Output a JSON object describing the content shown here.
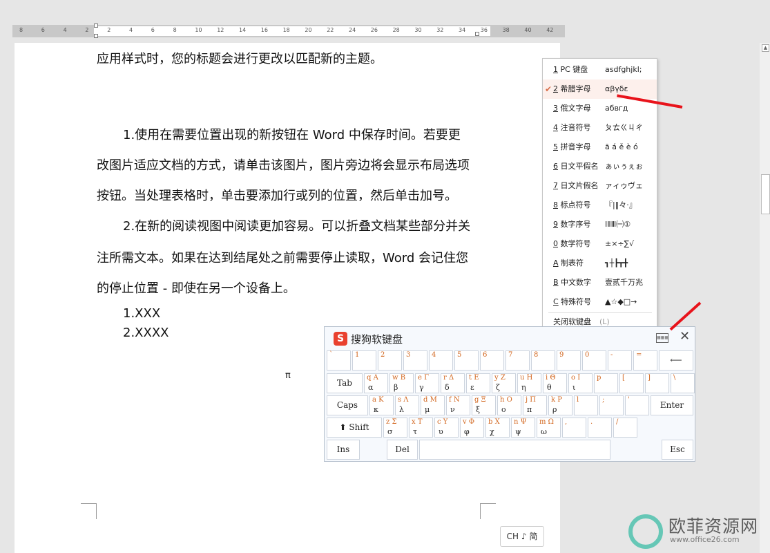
{
  "ruler": {
    "numbers": [
      "8",
      "6",
      "4",
      "2",
      "2",
      "4",
      "6",
      "8",
      "10",
      "12",
      "14",
      "16",
      "18",
      "20",
      "22",
      "24",
      "26",
      "28",
      "30",
      "32",
      "34",
      "36",
      "38",
      "40",
      "42"
    ]
  },
  "document": {
    "line_intro": "应用样式时，您的标题会进行更改以匹配新的主题。",
    "p1_lines": [
      "1.使用在需要位置出现的新按钮在 Word 中保存时间。若要更",
      "改图片适应文档的方式，请单击该图片，图片旁边将会显示布局选项",
      "按钮。当处理表格时，单击要添加行或列的位置，然后单击加号。"
    ],
    "p2_lines": [
      "2.在新的阅读视图中阅读更加容易。可以折叠文档某些部分并关",
      "注所需文本。如果在达到结尾处之前需要停止读取，Word 会记住您",
      "的停止位置 - 即使在另一个设备上。"
    ],
    "list": [
      "1.XXX",
      "2.XXXX"
    ],
    "pi": "π"
  },
  "menu": {
    "items": [
      {
        "key": "1",
        "label": " PC 键盘",
        "sample": "asdfghjkl;"
      },
      {
        "key": "2",
        "label": " 希腊字母",
        "sample": "αβγδε",
        "checked": true
      },
      {
        "key": "3",
        "label": " 俄文字母",
        "sample": "абвгд"
      },
      {
        "key": "4",
        "label": " 注音符号",
        "sample": "ㄆㄊㄍㄐㄔ"
      },
      {
        "key": "5",
        "label": " 拼音字母",
        "sample": "ā á ě è ó"
      },
      {
        "key": "6",
        "label": " 日文平假名",
        "sample": "ぁぃぅぇぉ"
      },
      {
        "key": "7",
        "label": " 日文片假名",
        "sample": "ァィゥヴェ"
      },
      {
        "key": "8",
        "label": " 标点符号",
        "sample": "『|‖々·』"
      },
      {
        "key": "9",
        "label": " 数字序号",
        "sample": "ⅠⅡⅢ㈠①"
      },
      {
        "key": "0",
        "label": " 数学符号",
        "sample": "±×÷∑√"
      },
      {
        "key": "A",
        "label": " 制表符",
        "sample": "┓┼┣┳╋"
      },
      {
        "key": "B",
        "label": " 中文数字",
        "sample": "壹贰千万兆"
      },
      {
        "key": "C",
        "label": " 特殊符号",
        "sample": "▲☆◆□→"
      }
    ],
    "close": "关闭软键盘",
    "close_hint": "(L)"
  },
  "keyboard": {
    "logo": "S",
    "title": "搜狗软键盘",
    "close": "✕",
    "row1": [
      {
        "t": "`",
        "b": ""
      },
      {
        "t": "1",
        "b": ""
      },
      {
        "t": "2",
        "b": ""
      },
      {
        "t": "3",
        "b": ""
      },
      {
        "t": "4",
        "b": ""
      },
      {
        "t": "5",
        "b": ""
      },
      {
        "t": "6",
        "b": ""
      },
      {
        "t": "7",
        "b": ""
      },
      {
        "t": "8",
        "b": ""
      },
      {
        "t": "9",
        "b": ""
      },
      {
        "t": "0",
        "b": ""
      },
      {
        "t": "-",
        "b": ""
      },
      {
        "t": "=",
        "b": ""
      }
    ],
    "backspace": "⟵",
    "tab": "Tab",
    "row2": [
      {
        "t": "q A",
        "b": "α"
      },
      {
        "t": "w B",
        "b": "β"
      },
      {
        "t": "e Γ",
        "b": "γ"
      },
      {
        "t": "r Δ",
        "b": "δ"
      },
      {
        "t": "t E",
        "b": "ε"
      },
      {
        "t": "y Z",
        "b": "ζ"
      },
      {
        "t": "u H",
        "b": "η"
      },
      {
        "t": "i Θ",
        "b": "θ"
      },
      {
        "t": "o I",
        "b": "ι"
      },
      {
        "t": "p",
        "b": ""
      },
      {
        "t": "[",
        "b": ""
      },
      {
        "t": "]",
        "b": ""
      },
      {
        "t": "\\",
        "b": ""
      }
    ],
    "caps": "Caps",
    "row3": [
      {
        "t": "a K",
        "b": "κ"
      },
      {
        "t": "s Λ",
        "b": "λ"
      },
      {
        "t": "d M",
        "b": "μ"
      },
      {
        "t": "f N",
        "b": "ν"
      },
      {
        "t": "g Ξ",
        "b": "ξ"
      },
      {
        "t": "h O",
        "b": "ο"
      },
      {
        "t": "j Π",
        "b": "π"
      },
      {
        "t": "k P",
        "b": "ρ"
      },
      {
        "t": "l",
        "b": ""
      },
      {
        "t": ";",
        "b": ""
      },
      {
        "t": "'",
        "b": ""
      }
    ],
    "enter": "Enter",
    "shift": "⬆ Shift",
    "row4": [
      {
        "t": "z Σ",
        "b": "σ"
      },
      {
        "t": "x T",
        "b": "τ"
      },
      {
        "t": "c Υ",
        "b": "υ"
      },
      {
        "t": "v Φ",
        "b": "φ"
      },
      {
        "t": "b X",
        "b": "χ"
      },
      {
        "t": "n Ψ",
        "b": "ψ"
      },
      {
        "t": "m Ω",
        "b": "ω"
      },
      {
        "t": ",",
        "b": ""
      },
      {
        "t": ".",
        "b": ""
      },
      {
        "t": "/",
        "b": ""
      }
    ],
    "ins": "Ins",
    "del": "Del",
    "esc": "Esc"
  },
  "ime_status": "CH ♪ 简",
  "watermark": {
    "title": "欧菲资源网",
    "url": "www.office26.com"
  },
  "colors": {
    "arrow": "#e8131b",
    "check": "#d8704c",
    "key_top": "#d2661e"
  }
}
